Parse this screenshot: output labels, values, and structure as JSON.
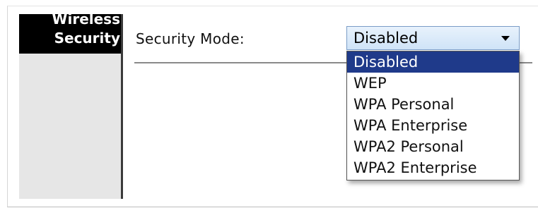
{
  "sidebar": {
    "title_line1": "Wireless",
    "title_line2": "Security"
  },
  "form": {
    "security_mode_label": "Security Mode:",
    "security_mode_value": "Disabled",
    "options": [
      "Disabled",
      "WEP",
      "WPA Personal",
      "WPA Enterprise",
      "WPA2 Personal",
      "WPA2 Enterprise"
    ],
    "highlighted_option": "Disabled"
  },
  "colors": {
    "sidebar_header_bg": "#000000",
    "sidebar_bg": "#e6e6e6",
    "highlight_bg": "#1f3a8a",
    "select_bg": "#cfe3f7"
  }
}
